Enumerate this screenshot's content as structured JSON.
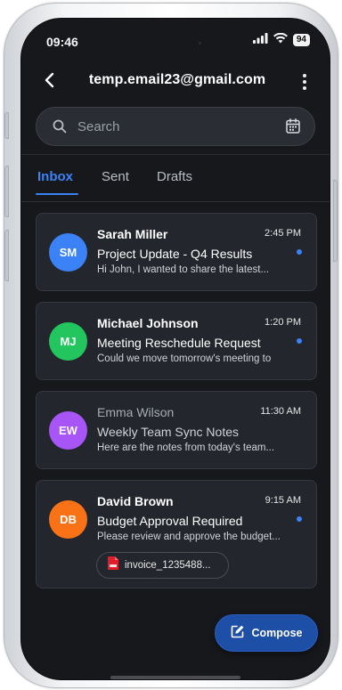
{
  "status_bar": {
    "time": "09:46",
    "battery": "94"
  },
  "header": {
    "title": "temp.email23@gmail.com"
  },
  "search": {
    "placeholder": "Search"
  },
  "tabs": [
    {
      "label": "Inbox",
      "active": true
    },
    {
      "label": "Sent",
      "active": false
    },
    {
      "label": "Drafts",
      "active": false
    }
  ],
  "emails": [
    {
      "initials": "SM",
      "avatar_color": "#3b82f6",
      "sender": "Sarah Miller",
      "time": "2:45 PM",
      "subject": "Project Update - Q4 Results",
      "preview": "Hi John, I wanted to share the latest...",
      "unread": true
    },
    {
      "initials": "MJ",
      "avatar_color": "#22c55e",
      "sender": "Michael Johnson",
      "time": "1:20 PM",
      "subject": "Meeting Reschedule Request",
      "preview": "Could we move tomorrow's meeting to",
      "unread": true
    },
    {
      "initials": "EW",
      "avatar_color": "#a855f7",
      "sender": "Emma Wilson",
      "time": "11:30 AM",
      "subject": "Weekly Team Sync Notes",
      "preview": "Here are the notes from today's team...",
      "unread": false
    },
    {
      "initials": "DB",
      "avatar_color": "#f97316",
      "sender": "David Brown",
      "time": "9:15 AM",
      "subject": "Budget Approval Required",
      "preview": "Please review and approve the budget...",
      "unread": true,
      "attachment": "invoice_1235488..."
    }
  ],
  "compose": {
    "label": "Compose"
  },
  "colors": {
    "accent": "#3b82f6",
    "background": "#17181c",
    "card": "#23262c",
    "compose": "#1e4fa6"
  }
}
